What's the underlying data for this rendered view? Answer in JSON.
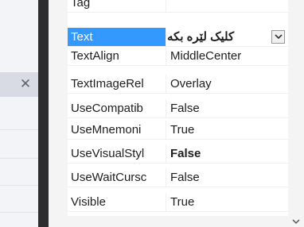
{
  "background_panel": {
    "close_glyph": "✕"
  },
  "property_grid": {
    "rows": [
      {
        "name": "Tag",
        "value": ""
      },
      {
        "name": "Text",
        "value": "کلیک لێره بکه"
      },
      {
        "name": "TextAlign",
        "value": "MiddleCenter"
      },
      {
        "name": "TextImageRel",
        "value": "Overlay"
      },
      {
        "name": "UseCompatib",
        "value": "False"
      },
      {
        "name": "UseMnemoni",
        "value": "True"
      },
      {
        "name": "UseVisualStyl",
        "value": "False"
      },
      {
        "name": "UseWaitCursc",
        "value": "False"
      },
      {
        "name": "Visible",
        "value": "True"
      }
    ],
    "selected_row": 1,
    "bold_value_row": 6
  },
  "colors": {
    "selection": "#3399ff",
    "splitter": "#2d2d30"
  },
  "icons": {
    "dropdown": "chevron-down-icon",
    "close": "close-icon",
    "scroll_down": "scroll-down-arrow-icon"
  }
}
